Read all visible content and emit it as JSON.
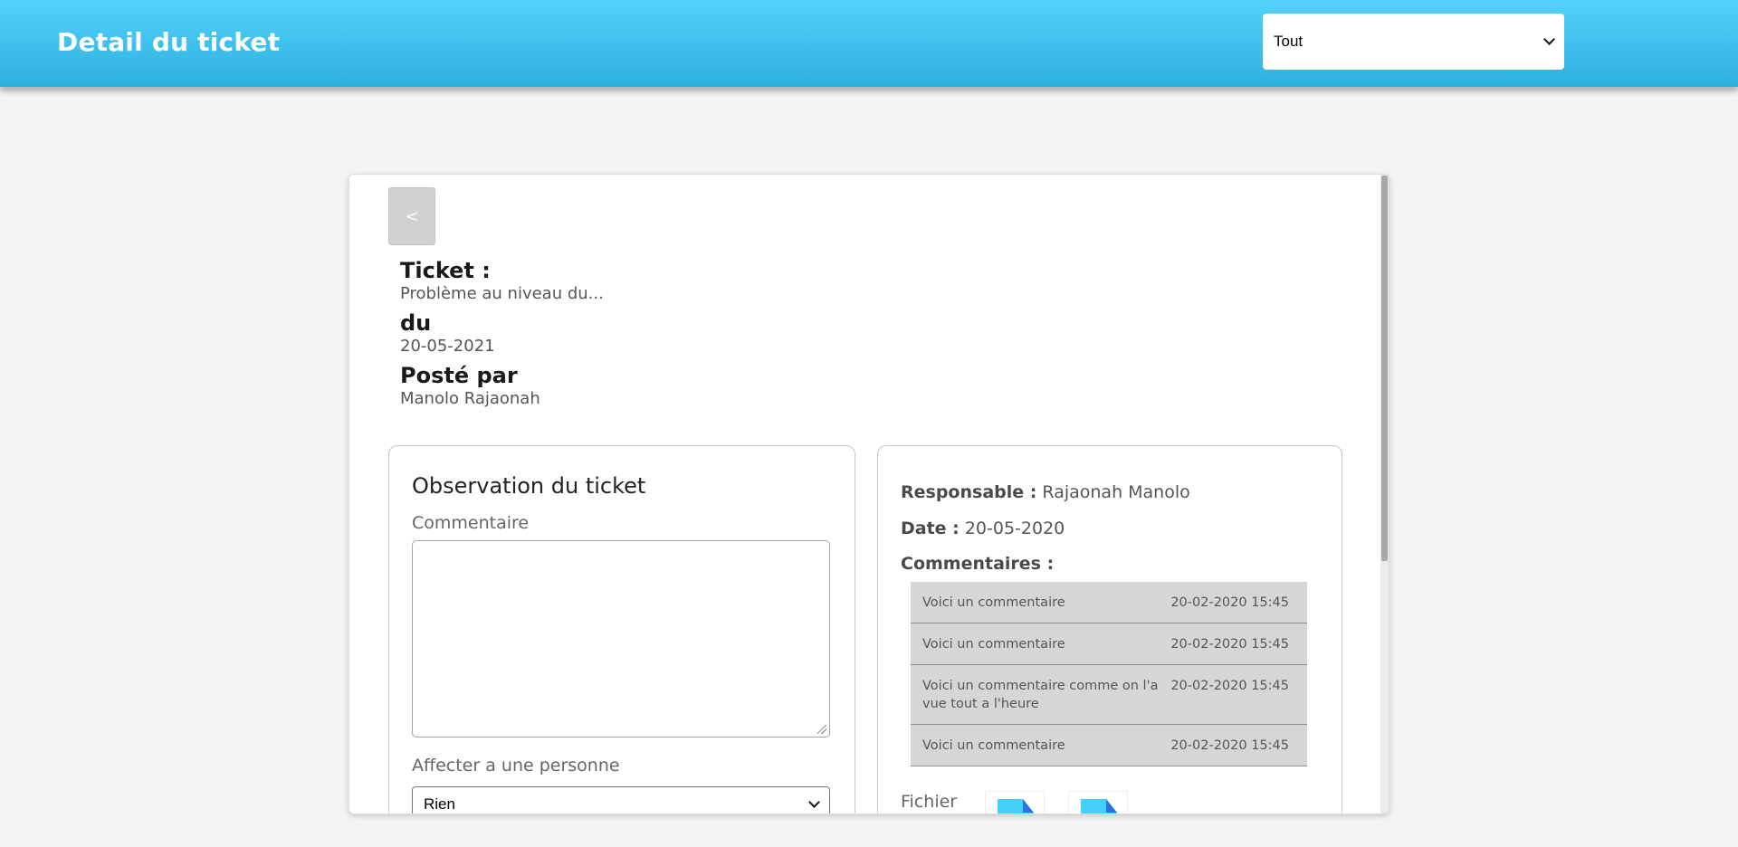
{
  "header": {
    "title": "Detail du ticket",
    "filter_value": "Tout"
  },
  "ticket": {
    "back_label": "<",
    "ticket_label": "Ticket :",
    "ticket_value": "Problème au niveau du...",
    "date_label": "du",
    "date_value": "20-05-2021",
    "posted_label": "Posté par",
    "posted_value": "Manolo Rajaonah"
  },
  "observation": {
    "title": "Observation du ticket",
    "comment_label": "Commentaire",
    "comment_value": "",
    "assign_label": "Affecter a une personne",
    "assign_value": "Rien"
  },
  "details": {
    "responsable_label": "Responsable :",
    "responsable_value": "Rajaonah Manolo",
    "date_label": "Date :",
    "date_value": "20-05-2020",
    "comments_label": "Commentaires :",
    "comments": [
      {
        "text": "Voici un commentaire",
        "time": "20-02-2020 15:45"
      },
      {
        "text": "Voici un commentaire",
        "time": "20-02-2020 15:45"
      },
      {
        "text": "Voici un commentaire comme on l'a vue tout a l'heure",
        "time": "20-02-2020 15:45"
      },
      {
        "text": "Voici un commentaire",
        "time": "20-02-2020 15:45"
      }
    ],
    "files_label": "Fichier",
    "files": [
      "file-icon",
      "file-icon"
    ]
  },
  "colors": {
    "header_gradient_top": "#52d1fb",
    "header_gradient_bottom": "#2eb0de",
    "comment_bg": "#d6d6d6",
    "file_icon": "#3fd0fb",
    "file_icon_fold": "#2a73e0"
  }
}
